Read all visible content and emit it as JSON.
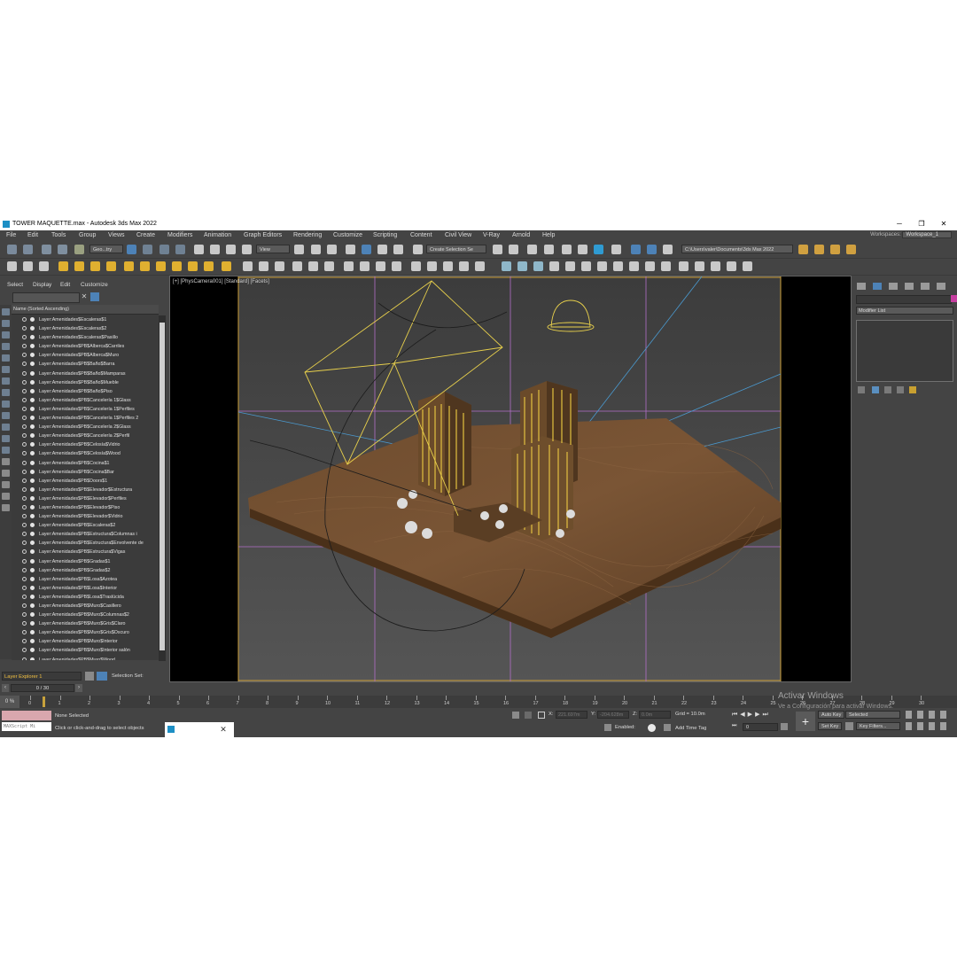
{
  "window": {
    "title": "TOWER MAQUETTE.max - Autodesk 3ds Max 2022",
    "minimize": "─",
    "restore": "❐",
    "close": "✕"
  },
  "menu": [
    "File",
    "Edit",
    "Tools",
    "Group",
    "Views",
    "Create",
    "Modifiers",
    "Animation",
    "Graph Editors",
    "Rendering",
    "Customize",
    "Scripting",
    "Content",
    "Civil View",
    "V-Ray",
    "Arnold",
    "Help"
  ],
  "workspace": {
    "label": "Workspaces:",
    "value": "Workspace_1"
  },
  "toolbar": {
    "geometry_dd": "Geo...try",
    "view_dd": "View",
    "selection_set_dd": "Create Selection Se",
    "project_path": "C:\\Users\\valer\\Documents\\3ds Max 2022"
  },
  "scene_explorer": {
    "tabs": [
      "Select",
      "Display",
      "Edit",
      "Customize"
    ],
    "column_header": "Name (Sorted Ascending)",
    "layers": [
      "Layer:Amenidades$Escaleras$1",
      "Layer:Amenidades$Escaleras$2",
      "Layer:Amenidades$Escaleras$Pasillo",
      "Layer:Amenidades$PB$Alberca$Carriles",
      "Layer:Amenidades$PB$Alberca$Muro",
      "Layer:Amenidades$PB$Baño$Barra",
      "Layer:Amenidades$PB$Baño$Mamparas",
      "Layer:Amenidades$PB$Baño$Mueble",
      "Layer:Amenidades$PB$Baño$Piso",
      "Layer:Amenidades$PB$Cancelería 1$Glass",
      "Layer:Amenidades$PB$Cancelería 1$Perfiles",
      "Layer:Amenidades$PB$Cancelería 1$Perfiles 2",
      "Layer:Amenidades$PB$Cancelería 2$Glass",
      "Layer:Amenidades$PB$Cancelería 2$Perfil",
      "Layer:Amenidades$PB$Celosía$Vidrio",
      "Layer:Amenidades$PB$Celosía$Wood",
      "Layer:Amenidades$PB$Cocina$1",
      "Layer:Amenidades$PB$Cocina$Bar",
      "Layer:Amenidades$PB$Doors$1",
      "Layer:Amenidades$PB$Elevador$Estructura",
      "Layer:Amenidades$PB$Elevador$Perfiles",
      "Layer:Amenidades$PB$Elevador$Piso",
      "Layer:Amenidades$PB$Elevador$Vidrio",
      "Layer:Amenidades$PB$Escaleras$2",
      "Layer:Amenidades$PB$Estructura$Columnas i",
      "Layer:Amenidades$PB$Estructura$Envolvente de",
      "Layer:Amenidades$PB$Estructura$Vigas",
      "Layer:Amenidades$PB$Gradas$1",
      "Layer:Amenidades$PB$Gradas$2",
      "Layer:Amenidades$PB$Losa$Azotea",
      "Layer:Amenidades$PB$Losa$Interior",
      "Layer:Amenidades$PB$Losa$Traslúcida",
      "Layer:Amenidades$PB$Muro$Casillero",
      "Layer:Amenidades$PB$Muro$Columnas$2",
      "Layer:Amenidades$PB$Muro$Gris$Claro",
      "Layer:Amenidades$PB$Muro$Gris$Oscuro",
      "Layer:Amenidades$PB$Muro$Interior",
      "Layer:Amenidades$PB$Muro$Interior salón",
      "Layer:Amenidades$PB$Muro$Wood"
    ],
    "explorer_dd": "Layer Explorer 1",
    "selection_set_label": "Selection Set:"
  },
  "viewport": {
    "label": "[+] [PhysCamera001] [Standard] [Facets]"
  },
  "command_panel": {
    "modifier_list": "Modifier List",
    "object_color": "#c63ea0"
  },
  "timeline": {
    "frame_counter": "0 / 30",
    "ticks": [
      "0",
      "1",
      "2",
      "3",
      "4",
      "5",
      "6",
      "7",
      "8",
      "9",
      "10",
      "11",
      "12",
      "13",
      "14",
      "15",
      "16",
      "17",
      "18",
      "19",
      "20",
      "21",
      "22",
      "23",
      "24",
      "25",
      "26",
      "27",
      "28",
      "29",
      "30"
    ],
    "frame_label": "0 %"
  },
  "status": {
    "maxscript": "MAXScript Mi",
    "selection": "None Selected",
    "prompt": "Click or click-and-drag to select objects",
    "x_label": "X:",
    "x_value": "221.697m",
    "y_label": "Y:",
    "y_value": "-204.628m",
    "z_label": "Z:",
    "z_value": "0.0m",
    "grid": "Grid = 10.0m",
    "enabled": "Enabled:",
    "add_time_tag": "Add Time Tag",
    "auto_key": "Auto Key",
    "selected_dd": "Selected",
    "set_key": "Set Key",
    "key_filters": "Key Filters...",
    "frame_value": "0"
  },
  "watermark": {
    "line1": "Activar Windows",
    "line2": "Ve a Configuración para activar Windows."
  }
}
